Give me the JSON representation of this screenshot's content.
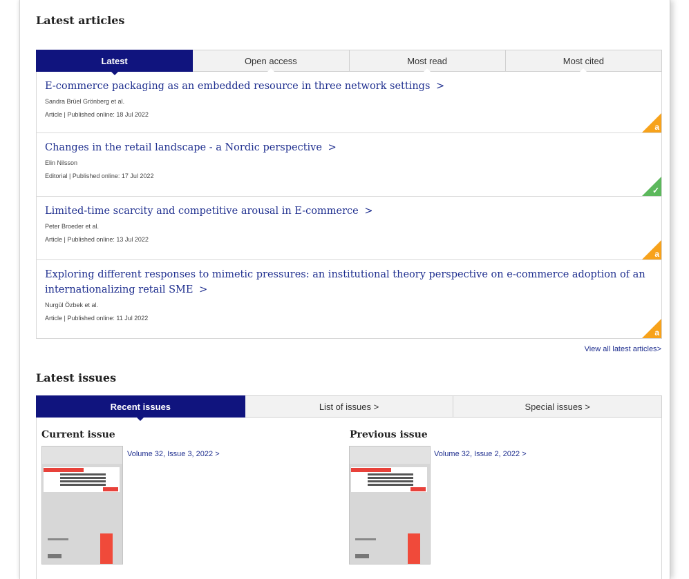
{
  "latest_articles": {
    "title": "Latest articles",
    "tabs": [
      {
        "label": "Latest"
      },
      {
        "label": "Open access"
      },
      {
        "label": "Most read"
      },
      {
        "label": "Most cited"
      }
    ],
    "articles": [
      {
        "title": "E-commerce packaging as an embedded resource in three network settings",
        "author": "Sandra Brüel Grönberg et al.",
        "meta": "Article | Published online: 18 Jul 2022",
        "badge": "open-access"
      },
      {
        "title": "Changes in the retail landscape - a Nordic perspective",
        "author": "Elin Nilsson",
        "meta": "Editorial | Published online: 17 Jul 2022",
        "badge": "free-access"
      },
      {
        "title": "Limited-time scarcity and competitive arousal in E-commerce",
        "author": "Peter Broeder et al.",
        "meta": "Article | Published online: 13 Jul 2022",
        "badge": "open-access"
      },
      {
        "title": "Exploring different responses to mimetic pressures: an institutional theory perspective on e-commerce adoption of an internationalizing retail SME",
        "author": "Nurgül Özbek et al.",
        "meta": "Article | Published online: 11 Jul 2022",
        "badge": "open-access"
      }
    ],
    "chevron": ">",
    "view_all": "View all latest articles"
  },
  "latest_issues": {
    "title": "Latest issues",
    "tabs": [
      {
        "label": "Recent issues"
      },
      {
        "label": "List of issues >"
      },
      {
        "label": "Special issues >"
      }
    ],
    "current": {
      "heading": "Current issue",
      "link": "Volume 32, Issue 3, 2022 >"
    },
    "previous": {
      "heading": "Previous issue",
      "link": "Volume 32, Issue 2, 2022 >"
    },
    "cover": {
      "line1": "The International Review of",
      "line2": "Retail,",
      "line3": "Distribution and",
      "line4": "Consumer",
      "line5": "Research"
    }
  },
  "colors": {
    "accent": "#10147e",
    "link": "#1f2f8f",
    "open_access": "#f7a21b",
    "free_access": "#5cb85c"
  },
  "icons": {
    "open_access": "open-access-icon",
    "free_access": "free-access-check-icon",
    "chevron": "chevron-right-icon"
  }
}
